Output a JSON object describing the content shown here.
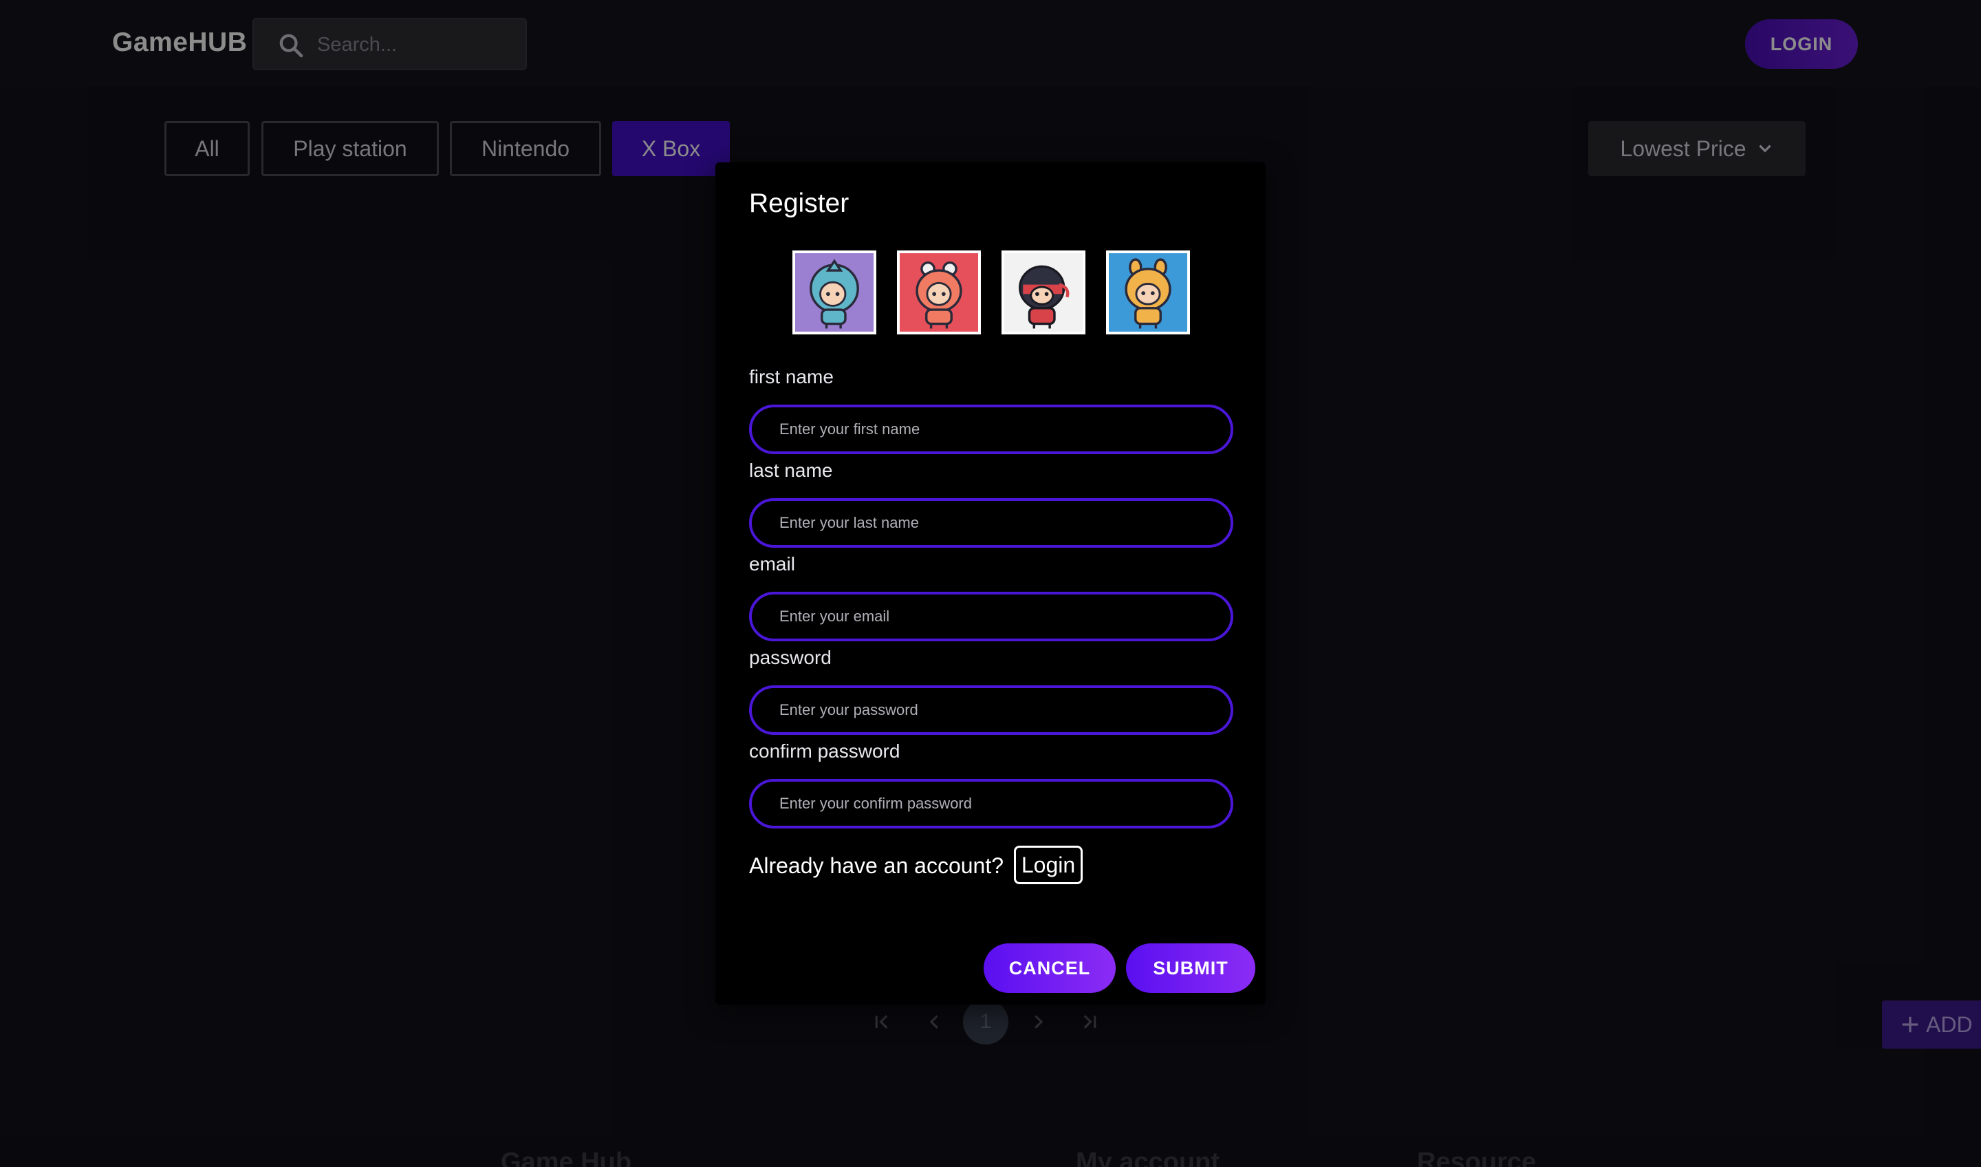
{
  "header": {
    "brand": "GameHUB",
    "search_placeholder": "Search...",
    "login_label": "LOGIN"
  },
  "filters": {
    "items": [
      "All",
      "Play station",
      "Nintendo",
      "X Box"
    ],
    "active": "X Box",
    "sort_label": "Lowest Price"
  },
  "pagination": {
    "current_page": "1"
  },
  "fab": {
    "add_label": "ADD"
  },
  "footer": {
    "headings": [
      "Game Hub",
      "My account",
      "Resource"
    ]
  },
  "register_modal": {
    "title": "Register",
    "avatars": [
      {
        "name": "avatar-shark-costume",
        "bg": "#9b7fd0"
      },
      {
        "name": "avatar-crab-costume",
        "bg": "#e6505a"
      },
      {
        "name": "avatar-ninja-costume",
        "bg": "#f2f2f2"
      },
      {
        "name": "avatar-frog-costume",
        "bg": "#3c9ad8"
      }
    ],
    "fields": {
      "first_name": {
        "label": "first name",
        "placeholder": "Enter your first name",
        "value": ""
      },
      "last_name": {
        "label": "last name",
        "placeholder": "Enter your last name",
        "value": ""
      },
      "email": {
        "label": "email",
        "placeholder": "Enter your email",
        "value": ""
      },
      "password": {
        "label": "password",
        "placeholder": "Enter your password",
        "value": ""
      },
      "confirm_password": {
        "label": "confirm password",
        "placeholder": "Enter your confirm password",
        "value": ""
      }
    },
    "already_text": "Already have an account?",
    "login_link": "Login",
    "cancel_label": "CANCEL",
    "submit_label": "SUBMIT"
  },
  "colors": {
    "accent": "#4a16d8",
    "active_filter": "#4310c9",
    "button_gradient_start": "#5a0ff0",
    "button_gradient_end": "#8b2cf5"
  }
}
